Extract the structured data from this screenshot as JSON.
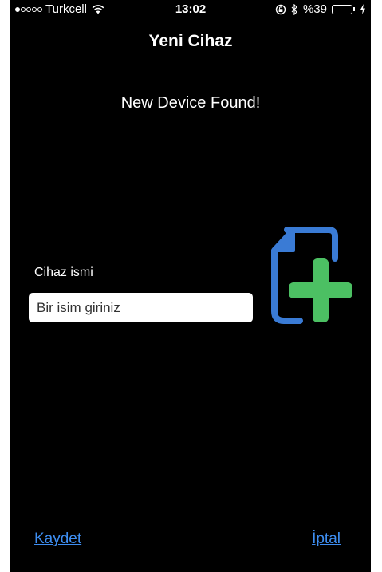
{
  "status_bar": {
    "carrier": "Turkcell",
    "time": "13:02",
    "battery_percent": "%39",
    "battery_level": 0.39,
    "signal_bars": 1,
    "icons": [
      "wifi-icon",
      "rotation-lock-icon",
      "bluetooth-icon",
      "battery-icon",
      "charging-icon"
    ]
  },
  "nav": {
    "title": "Yeni Cihaz"
  },
  "main": {
    "heading": "New Device Found!",
    "field_label": "Cihaz ismi",
    "input_placeholder": "Bir isim giriniz",
    "input_value": ""
  },
  "actions": {
    "save": "Kaydet",
    "cancel": "İptal"
  },
  "colors": {
    "background": "#000000",
    "text": "#ffffff",
    "link": "#3e8ef2",
    "icon_document": "#3a7bd5",
    "icon_plus": "#4cc063",
    "battery": "#f5c518"
  }
}
